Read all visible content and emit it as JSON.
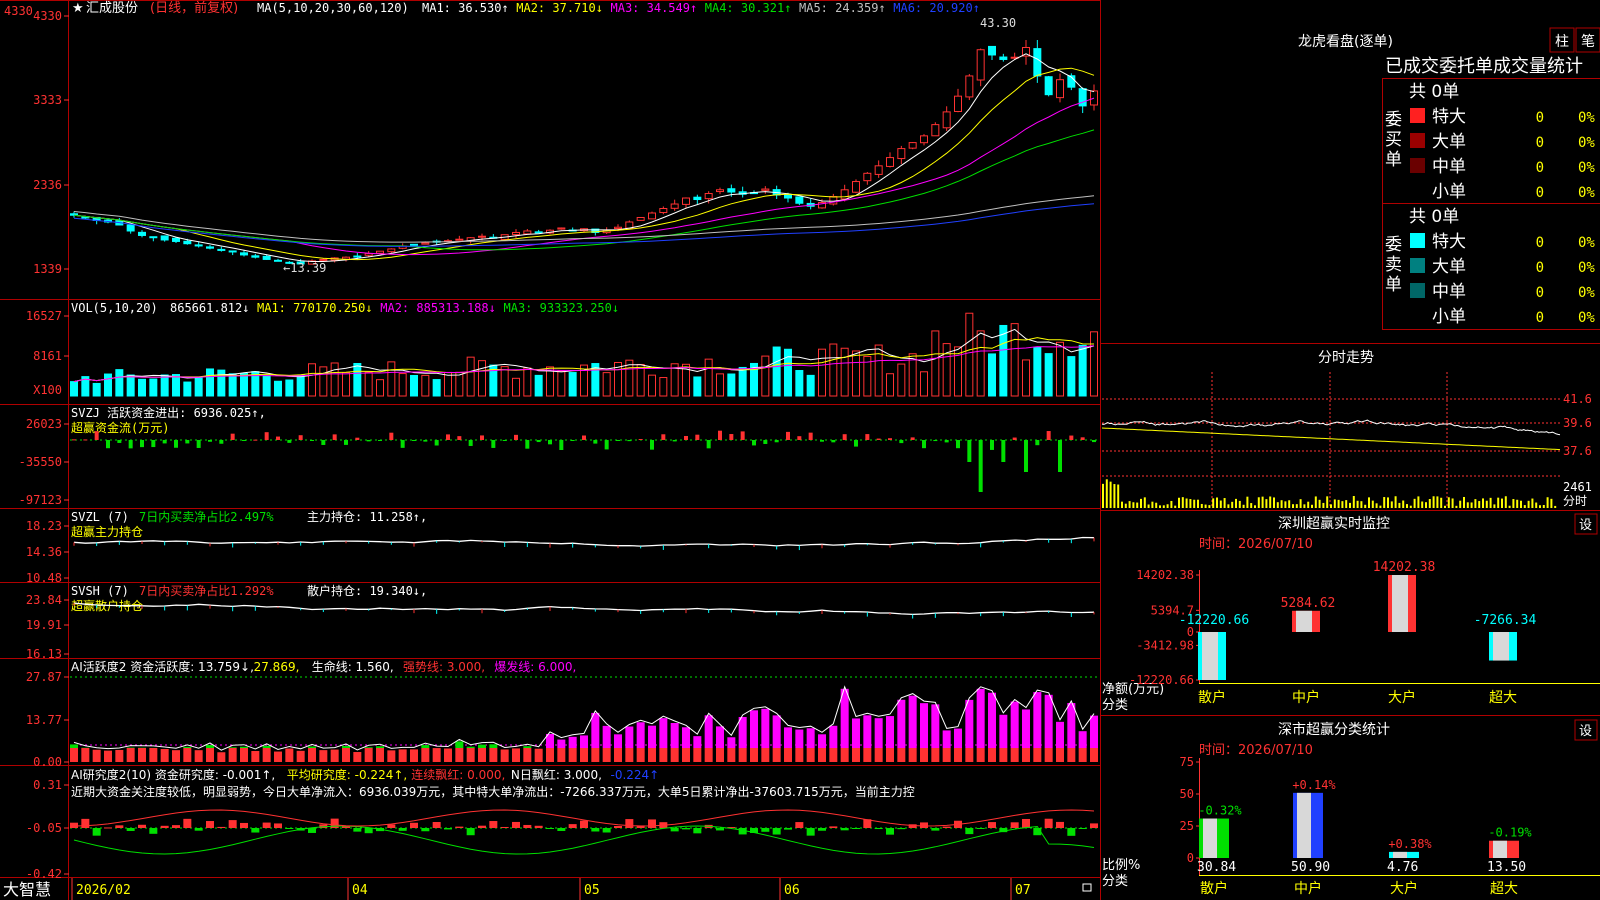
{
  "colors": {
    "red": "#ff3232",
    "cyan": "#00ffff",
    "white": "#ffffff",
    "yellow": "#ffff00",
    "magenta": "#ff00ff",
    "green": "#00e000",
    "blue": "#2040ff",
    "gray": "#c0c0c0",
    "border": "#b00000",
    "darkgreen": "#00a000"
  },
  "main_panel": {
    "stock_name": "汇成股份",
    "period_note": "(日线，前复权)",
    "ma_label": "MA(5,10,20,30,60,120)",
    "ma_items": [
      {
        "text": "MA1: 36.530↑",
        "color": "#ffffff"
      },
      {
        "text": "MA2: 37.710↓",
        "color": "#ffff00"
      },
      {
        "text": "MA3: 34.549↑",
        "color": "#ff00ff"
      },
      {
        "text": "MA4: 30.321↑",
        "color": "#00e000"
      },
      {
        "text": "MA5: 24.359↑",
        "color": "#c0c0c0"
      },
      {
        "text": "MA6: 20.920↑",
        "color": "#2040ff"
      }
    ],
    "y_ticks": [
      "4330",
      "3333",
      "2336",
      "1339"
    ],
    "high_label": "43.30",
    "low_label": "←13.39"
  },
  "vol_panel": {
    "title": "VOL(5,10,20)",
    "items": [
      {
        "text": "865661.812↓",
        "color": "#ffffff"
      },
      {
        "text": "MA1: 770170.250↓",
        "color": "#ffff00"
      },
      {
        "text": "MA2: 885313.188↓",
        "color": "#ff00ff"
      },
      {
        "text": "MA3: 933323.250↓",
        "color": "#00e000"
      }
    ],
    "y_ticks": [
      "16527",
      "8161"
    ],
    "unit": "X100"
  },
  "svzj_panel": {
    "title": "SVZJ  活跃资金进出: 6936.025↑,",
    "subtitle": "超赢资金流(万元)",
    "y_ticks": [
      "26023",
      "-35550",
      "-97123"
    ]
  },
  "svzl_panel": {
    "title_a": "SVZL (7)",
    "title_b": "7日内买卖净占比2.497%",
    "title_c": "主力持仓: 11.258↑,",
    "subtitle": "超赢主力持仓",
    "y_ticks": [
      "18.23",
      "14.36",
      "10.48"
    ]
  },
  "svsh_panel": {
    "title_a": "SVSH (7)",
    "title_b": "7日内买卖净占比1.292%",
    "title_c": "散户持仓: 19.340↓,",
    "subtitle": "超赢散户持仓",
    "y_ticks": [
      "23.84",
      "19.91",
      "16.13"
    ]
  },
  "ai2_panel": {
    "items": [
      {
        "text": "AI活跃度2 资金活跃度: 13.759↓,",
        "color": "#ffffff"
      },
      {
        "text": "27.869,",
        "color": "#ffff00"
      },
      {
        "text": "生命线: 1.560,",
        "color": "#ffffff"
      },
      {
        "text": "强势线: 3.000,",
        "color": "#ff3232"
      },
      {
        "text": "爆发线: 6.000,",
        "color": "#ff00ff"
      }
    ],
    "y_ticks": [
      "27.87",
      "13.77",
      "0.00"
    ]
  },
  "ai_research_panel": {
    "items": [
      {
        "text": "AI研究度2(10) 资金研究度: -0.001↑,",
        "color": "#ffffff"
      },
      {
        "text": "平均研究度: -0.224↑,",
        "color": "#ffff00"
      },
      {
        "text": "连续飘红: 0.000,",
        "color": "#ff3232"
      },
      {
        "text": "N日飘红: 3.000,",
        "color": "#ffffff"
      },
      {
        "text": "-0.224↑",
        "color": "#2040ff"
      }
    ],
    "commentary": "近期大资金关注度较低，明显弱势，今日大单净流入：6936.039万元，其中特大单净流出：-7266.337万元，大单5日累计净出-37603.715万元，当前主力控",
    "y_ticks": [
      "0.31",
      "-0.05",
      "-0.42"
    ]
  },
  "date_axis": {
    "brand": "大智慧",
    "labels": [
      "2026/02",
      "04",
      "05",
      "06",
      "07"
    ]
  },
  "lhb": {
    "title": "龙虎看盘(逐单)",
    "btn_bar": "柱",
    "btn_pen": "笔",
    "tabs_label": "已成交委托单成交量统计",
    "buy": {
      "side_label": "委买单",
      "total": "共 0单",
      "rows": [
        {
          "label": "特大",
          "value": "0",
          "pct": "0%",
          "color": "#ff2020"
        },
        {
          "label": "大单",
          "value": "0",
          "pct": "0%",
          "color": "#9a0000"
        },
        {
          "label": "中单",
          "value": "0",
          "pct": "0%",
          "color": "#6a0000"
        },
        {
          "label": "小单",
          "value": "0",
          "pct": "0%",
          "color": ""
        }
      ]
    },
    "sell": {
      "side_label": "委卖单",
      "total": "共 0单",
      "rows": [
        {
          "label": "特大",
          "value": "0",
          "pct": "0%",
          "color": "#00ffff"
        },
        {
          "label": "大单",
          "value": "0",
          "pct": "0%",
          "color": "#008080"
        },
        {
          "label": "中单",
          "value": "0",
          "pct": "0%",
          "color": "#006666"
        },
        {
          "label": "小单",
          "value": "0",
          "pct": "0%",
          "color": ""
        }
      ]
    }
  },
  "intraday": {
    "title": "分时走势",
    "y_ticks": [
      "41.6",
      "39.6",
      "37.6"
    ],
    "vol_tick": "2461",
    "vol_unit": "分时"
  },
  "monitor": {
    "title": "深圳超赢实时监控",
    "btn": "设",
    "time_label": "时间：2026/07/10",
    "y_ticks": [
      "14202.38",
      "5394.7",
      "0",
      "-3412.98",
      "-12220.66"
    ],
    "y_label": "净额(万元)",
    "x_label": "分类",
    "categories": [
      "散户",
      "中户",
      "大户",
      "超大"
    ],
    "values": [
      -12220.66,
      5284.62,
      14202.38,
      -7266.34
    ],
    "value_labels": [
      "-12220.66",
      "5284.62",
      "14202.38",
      "-7266.34"
    ]
  },
  "classify": {
    "title": "深市超赢分类统计",
    "btn": "设",
    "time_label": "时间：2026/07/10",
    "y_ticks": [
      "75",
      "50",
      "25",
      "0"
    ],
    "y_label": "比例%",
    "x_label": "分类",
    "categories": [
      "散户",
      "中户",
      "大户",
      "超大"
    ],
    "values": [
      30.84,
      50.9,
      4.76,
      13.5
    ],
    "value_labels": [
      "30.84",
      "50.90",
      "4.76",
      "13.50"
    ],
    "change_labels": [
      "-0.32%",
      "+0.14%",
      "+0.38%",
      "-0.19%"
    ]
  },
  "chart_data": [
    {
      "type": "candlestick",
      "title": "汇成股份",
      "dates_start": "2026/02",
      "dates_end": "2026/07/10",
      "x_labels": [
        "2026/02",
        "04",
        "05",
        "06",
        "07"
      ],
      "close": [
        19.9,
        19.6,
        19.2,
        19.0,
        18.6,
        17.8,
        17.2,
        16.9,
        16.6,
        16.4,
        16.1,
        15.8,
        15.5,
        15.2,
        15.0,
        14.6,
        14.3,
        14.0,
        13.8,
        13.6,
        13.4,
        13.8,
        14.0,
        14.2,
        14.3,
        14.4,
        14.8,
        15.1,
        15.4,
        15.8,
        16.0,
        16.2,
        16.4,
        16.5,
        16.7,
        16.9,
        17.1,
        16.9,
        17.3,
        17.6,
        17.8,
        17.6,
        17.9,
        18.2,
        17.9,
        18.1,
        17.6,
        17.9,
        18.3,
        19.0,
        19.6,
        20.2,
        20.8,
        21.4,
        22.2,
        22.0,
        22.8,
        23.3,
        23.0,
        22.7,
        22.9,
        23.4,
        22.6,
        22.2,
        21.5,
        21.1,
        21.6,
        22.4,
        23.3,
        24.4,
        25.5,
        26.5,
        27.6,
        28.8,
        29.6,
        30.5,
        32.0,
        33.7,
        35.8,
        38.5,
        42.0,
        41.3,
        40.7,
        41.0,
        42.3,
        38.5,
        36.0,
        38.0,
        37.0,
        34.5,
        36.5
      ],
      "high": 43.3,
      "low": 13.39,
      "ma_names": [
        "MA1",
        "MA2",
        "MA3",
        "MA4",
        "MA5",
        "MA6"
      ],
      "ma_values": [
        36.53,
        37.71,
        34.549,
        30.321,
        24.359,
        20.92
      ]
    },
    {
      "type": "bar",
      "title": "VOL",
      "last": 865661.812,
      "ma": [
        770170.25,
        885313.188,
        933323.25
      ]
    },
    {
      "type": "bar",
      "title": "SVZJ",
      "last": 6936.025
    },
    {
      "type": "line",
      "title": "SVZL",
      "last": 11.258
    },
    {
      "type": "line",
      "title": "SVSH",
      "last": 19.34
    },
    {
      "type": "bar",
      "title": "AI活跃度2",
      "last": 13.759
    },
    {
      "type": "bar",
      "title": "AI研究度2",
      "last": -0.001
    },
    {
      "type": "bar",
      "title": "深圳超赢实时监控",
      "categories": [
        "散户",
        "中户",
        "大户",
        "超大"
      ],
      "values": [
        -12220.66,
        5284.62,
        14202.38,
        -7266.34
      ]
    },
    {
      "type": "bar",
      "title": "深市超赢分类统计",
      "categories": [
        "散户",
        "中户",
        "大户",
        "超大"
      ],
      "values": [
        30.84,
        50.9,
        4.76,
        13.5
      ]
    }
  ]
}
